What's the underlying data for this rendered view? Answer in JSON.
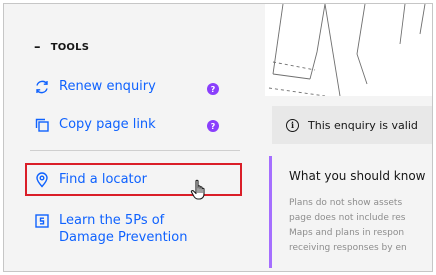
{
  "sidebar": {
    "section_title": "TOOLS",
    "collapse_glyph": "–",
    "items": [
      {
        "label": "Renew enquiry",
        "icon": "renew-icon",
        "badge": "?"
      },
      {
        "label": "Copy page link",
        "icon": "copy-icon",
        "badge": "?"
      },
      {
        "label": "Find a locator",
        "icon": "location-pin-icon"
      },
      {
        "label_line1": "Learn the 5Ps of",
        "label_line2": "Damage Prevention",
        "icon": "document-s-icon"
      }
    ]
  },
  "info_bar": {
    "text": "This enquiry is valid",
    "icon": "info-icon"
  },
  "content": {
    "title": "What you should know",
    "lines": [
      "Plans do not show assets",
      "page does not include res",
      "Maps and plans in respon",
      "receiving responses by en"
    ]
  },
  "colors": {
    "link": "#0f62fe",
    "badge": "#8a3ffc",
    "highlight": "#da1e28",
    "accent": "#a56eff",
    "panel_bg": "#f4f4f4"
  }
}
